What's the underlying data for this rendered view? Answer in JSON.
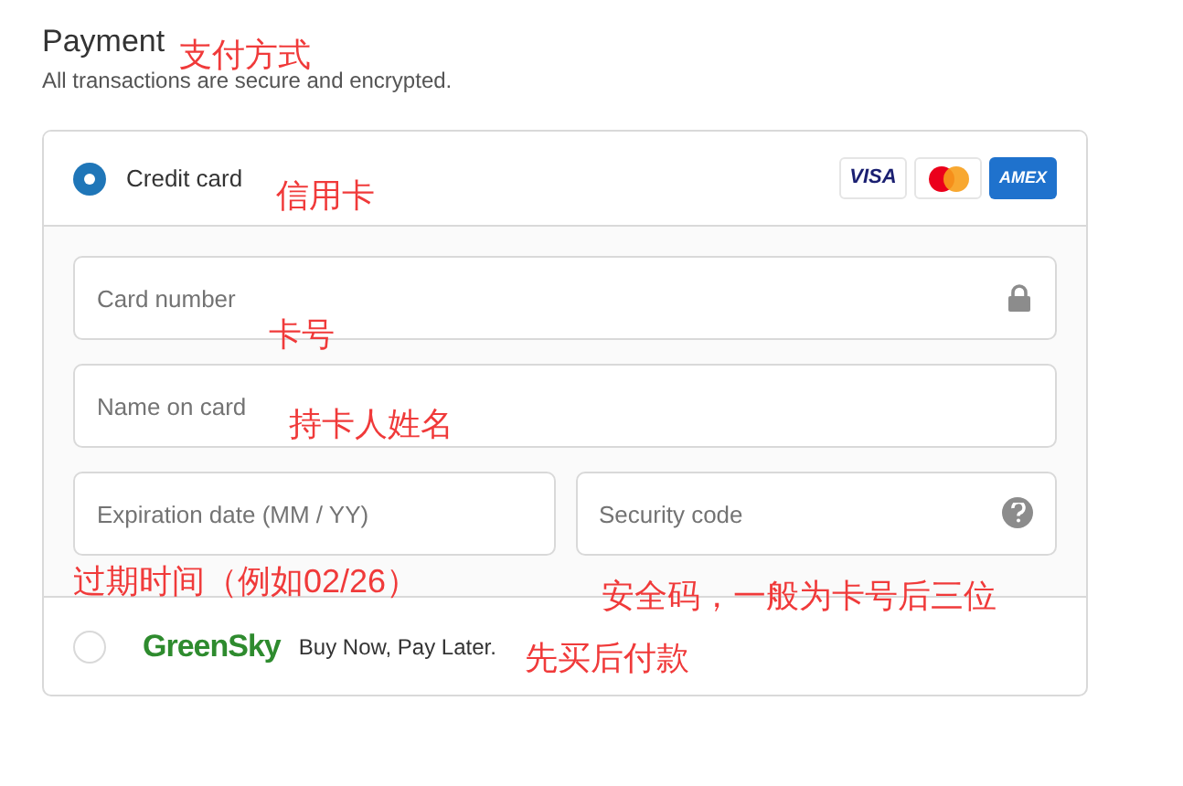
{
  "heading": "Payment",
  "subtitle": "All transactions are secure and encrypted.",
  "payment_methods": [
    {
      "kind": "card",
      "label": "Credit card",
      "selected": true,
      "logos": [
        {
          "kind": "visa",
          "text": "VISA"
        },
        {
          "kind": "mastercard"
        },
        {
          "kind": "amex",
          "text": "AMEX"
        }
      ],
      "fields": [
        {
          "placeholder": "Card number",
          "kind": "card_number"
        },
        {
          "placeholder": "Name on card",
          "kind": "text"
        },
        {
          "placeholder": "Expiration date (MM / YY)",
          "kind": "text"
        },
        {
          "placeholder": "Security code",
          "kind": "security_code"
        }
      ]
    },
    {
      "kind": "bnpl",
      "brand": "GreenSky",
      "label": "Buy Now, Pay Later.",
      "selected": false
    }
  ],
  "annotations": [
    "支付方式",
    "信用卡",
    "卡号",
    "持卡人姓名",
    "过期时间（例如02/26）",
    "安全码，一般为卡号后三位",
    "先买后付款"
  ]
}
